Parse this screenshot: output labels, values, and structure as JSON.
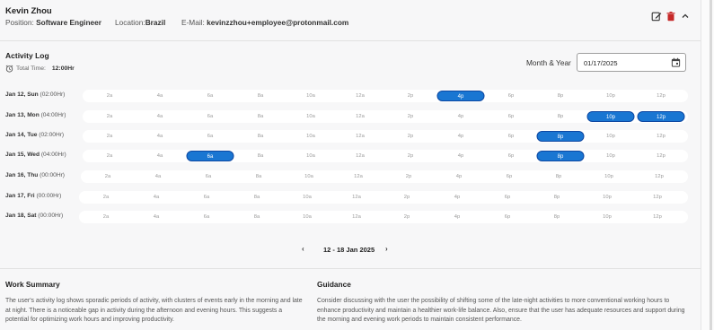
{
  "user": {
    "name": "Kevin Zhou",
    "position_label": "Position:",
    "position": "Software Engineer",
    "location_label": "Location:",
    "location": "Brazil",
    "email_label": "E-Mail:",
    "email": "kevinzzhou+employee@protonmail.com"
  },
  "header_icons": [
    "edit-icon",
    "delete-icon",
    "chevron-up-icon"
  ],
  "activity": {
    "title": "Activity Log",
    "total_time_label": "Total Time:",
    "total_time": "12:00Hr",
    "month_year_label": "Month & Year",
    "date_value": "01/17/2025"
  },
  "time_ticks": [
    "2a",
    "4a",
    "6a",
    "8a",
    "10a",
    "12a",
    "2p",
    "4p",
    "6p",
    "8p",
    "10p",
    "12p"
  ],
  "days": [
    {
      "label": "Jan 12, Sun",
      "hours": "(02:00Hr)",
      "active": [
        "4p"
      ]
    },
    {
      "label": "Jan 13, Mon",
      "hours": "(04:00Hr)",
      "active": [
        "10p",
        "12p"
      ]
    },
    {
      "label": "Jan 14, Tue",
      "hours": "(02:00Hr)",
      "active": [
        "8p"
      ]
    },
    {
      "label": "Jan 15, Wed",
      "hours": "(04:00Hr)",
      "active": [
        "6a",
        "8p"
      ]
    },
    {
      "label": "Jan 16, Thu",
      "hours": "(00:00Hr)",
      "active": []
    },
    {
      "label": "Jan 17, Fri",
      "hours": "(00:00Hr)",
      "active": []
    },
    {
      "label": "Jan 18, Sat",
      "hours": "(00:00Hr)",
      "active": []
    }
  ],
  "week_nav": {
    "prev": "‹",
    "range": "12 - 18 Jan 2025",
    "next": "›"
  },
  "work_summary": {
    "title": "Work Summary",
    "body": "The user's activity log shows sporadic periods of activity, with clusters of events early in the morning and late at night. There is a noticeable gap in activity during the afternoon and evening hours. This suggests a potential for optimizing work hours and improving productivity."
  },
  "guidance": {
    "title": "Guidance",
    "body": "Consider discussing with the user the possibility of shifting some of the late-night activities to more conventional working hours to enhance productivity and maintain a healthier work-life balance. Also, ensure that the user has adequate resources and support during the morning and evening work periods to maintain consistent performance."
  },
  "colors": {
    "accent": "#1976d2",
    "delete": "#c62828",
    "background": "#f7f7f8"
  }
}
